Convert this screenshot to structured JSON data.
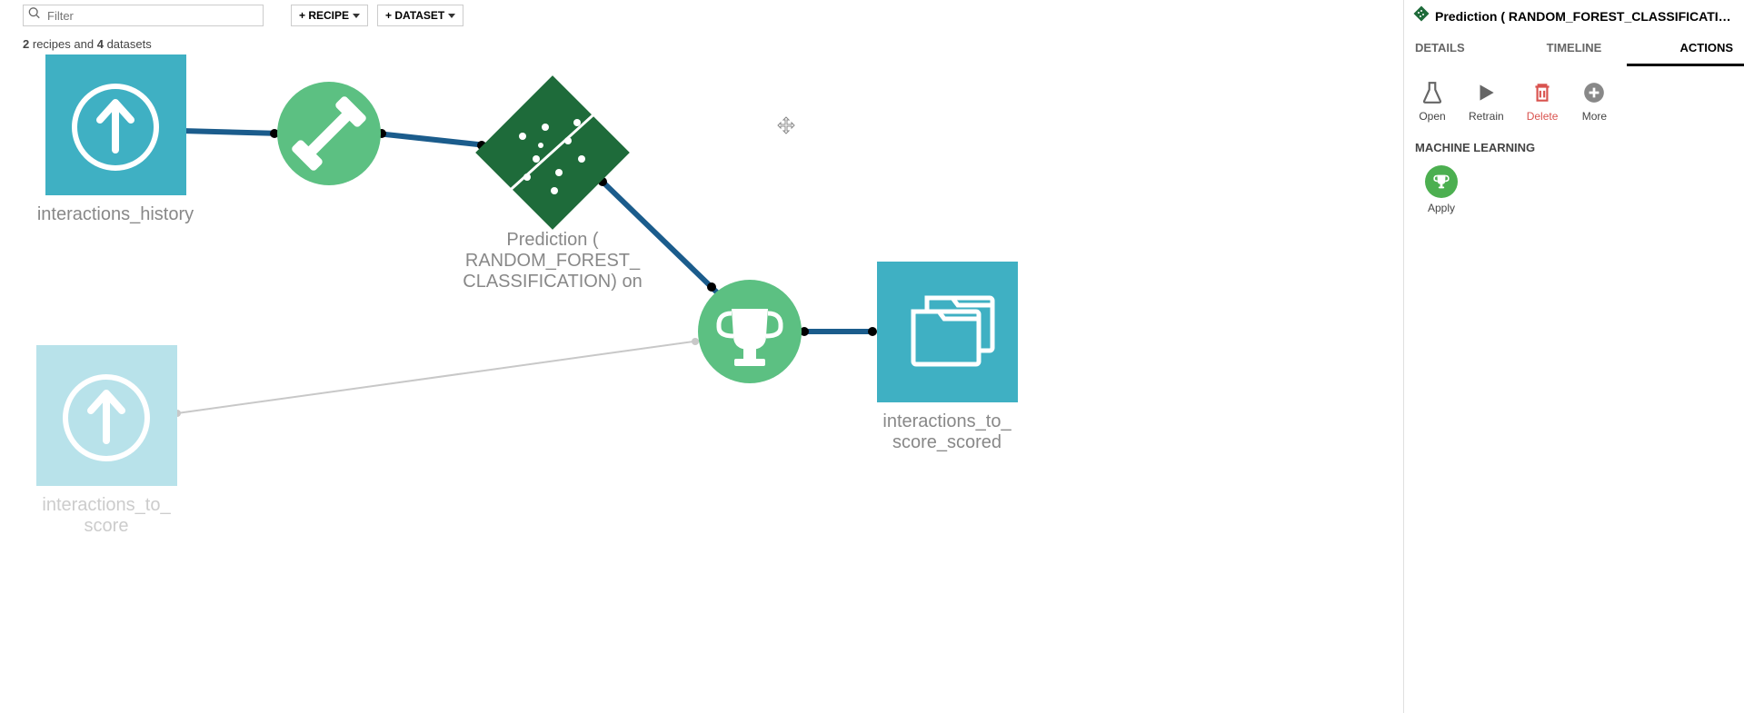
{
  "toolbar": {
    "filter_placeholder": "Filter",
    "recipe_btn": "+ RECIPE",
    "dataset_btn": "+ DATASET"
  },
  "summary": {
    "recipes_count": "2",
    "recipes_word": "recipes and",
    "datasets_count": "4",
    "datasets_word": "datasets"
  },
  "nodes": {
    "interactions_history": "interactions_history",
    "prediction_line1": "Prediction (",
    "prediction_line2": "RANDOM_FOREST_",
    "prediction_line3": "CLASSIFICATION) on",
    "interactions_to_score_scored_line1": "interactions_to_",
    "interactions_to_score_scored_line2": "score_scored",
    "interactions_to_score_line1": "interactions_to_",
    "interactions_to_score_line2": "score"
  },
  "panel": {
    "title": "Prediction ( RANDOM_FOREST_CLASSIFICATION) on inter...",
    "tabs": {
      "details": "DETAILS",
      "timeline": "TIMELINE",
      "actions": "ACTIONS"
    },
    "actions": {
      "open": "Open",
      "retrain": "Retrain",
      "delete": "Delete",
      "more": "More"
    },
    "ml_header": "MACHINE LEARNING",
    "apply": "Apply"
  },
  "colors": {
    "teal": "#3fb0c3",
    "teal_faded": "#b8e2ea",
    "green": "#5cc082",
    "dark_green": "#1e6b3a",
    "edge": "#1b5c8c",
    "edge_light": "#c8c8c8",
    "icon_gray": "#666666"
  }
}
